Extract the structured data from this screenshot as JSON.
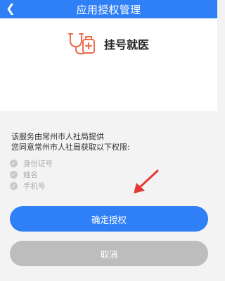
{
  "header": {
    "title": "应用授权管理",
    "back_icon": "chevron-left-icon"
  },
  "service": {
    "name": "挂号就医",
    "icon": "stethoscope-icon",
    "icon_color": "#f06a4a"
  },
  "consent": {
    "line1": "该服务由常州市人社局提供",
    "line2": "您同意常州市人社局获取以下权限:",
    "permissions": [
      "身份证号",
      "姓名",
      "手机号"
    ]
  },
  "buttons": {
    "confirm": "确定授权",
    "cancel": "取消"
  },
  "colors": {
    "primary": "#2f7ff7",
    "cancel": "#bdbdbd",
    "arrow": "#e53935"
  }
}
